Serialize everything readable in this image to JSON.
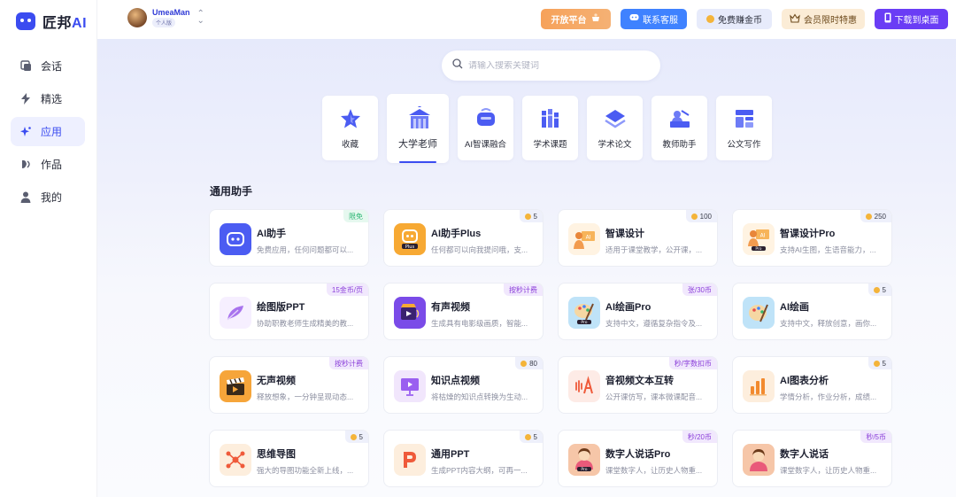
{
  "brand": {
    "name": "匠邦",
    "suffix": "AI"
  },
  "nav": [
    {
      "label": "会话",
      "icon": "chat-icon"
    },
    {
      "label": "精选",
      "icon": "lightning-icon"
    },
    {
      "label": "应用",
      "icon": "sparkle-icon",
      "active": true
    },
    {
      "label": "作品",
      "icon": "shapes-icon"
    },
    {
      "label": "我的",
      "icon": "user-icon"
    }
  ],
  "user": {
    "name": "UmeaMan",
    "badge": "个人版"
  },
  "topbar": {
    "open_platform": "开放平台",
    "service": "联系客服",
    "coins": "免费赚金币",
    "vip": "会员限时特惠",
    "download": "下载到桌面"
  },
  "search": {
    "placeholder": "请输入搜索关键词"
  },
  "categories": [
    {
      "label": "收藏",
      "icon": "star-icon"
    },
    {
      "label": "大学老师",
      "icon": "university-icon",
      "active": true
    },
    {
      "label": "AI智课融合",
      "icon": "ai-class-icon"
    },
    {
      "label": "学术课题",
      "icon": "books-icon"
    },
    {
      "label": "学术论文",
      "icon": "layers-icon"
    },
    {
      "label": "教师助手",
      "icon": "teacher-icon"
    },
    {
      "label": "公文写作",
      "icon": "document-icon"
    }
  ],
  "section_title": "通用助手",
  "cards": [
    {
      "title": "AI助手",
      "desc": "免费应用，任何问题都可以...",
      "badge": "限免",
      "badge_type": "free",
      "icon": "robot-icon",
      "color": "#4b5cf2"
    },
    {
      "title": "AI助手Plus",
      "desc": "任何都可以向我提问哦，支...",
      "badge": "5",
      "badge_type": "coin",
      "icon": "robot-plus-icon",
      "color": "#f7a933"
    },
    {
      "title": "智课设计",
      "desc": "适用于课堂教学，公开课，...",
      "badge": "100",
      "badge_type": "coin",
      "icon": "teacher-board-icon",
      "color": "#fde4c4"
    },
    {
      "title": "智课设计Pro",
      "desc": "支持AI生图，生语音能力，...",
      "badge": "250",
      "badge_type": "coin",
      "icon": "teacher-board-pro-icon",
      "color": "#fde4c4"
    },
    {
      "title": "绘图版PPT",
      "desc": "协助职教老师生成精美的教...",
      "badge": "15金币/页",
      "badge_type": "purple",
      "icon": "feather-icon",
      "color": "#f3eafd"
    },
    {
      "title": "有声视频",
      "desc": "生成具有电影级画质，智能...",
      "badge": "按秒计费",
      "badge_type": "purple",
      "icon": "video-sound-icon",
      "color": "#7a4be8"
    },
    {
      "title": "AI绘画Pro",
      "desc": "支持中文，遵循复杂指令及...",
      "badge": "张/30币",
      "badge_type": "purple",
      "icon": "palette-pro-icon",
      "color": "#a9d8f5"
    },
    {
      "title": "AI绘画",
      "desc": "支持中文，释放创意，画你...",
      "badge": "5",
      "badge_type": "coin",
      "icon": "palette-icon",
      "color": "#a9d8f5"
    },
    {
      "title": "无声视频",
      "desc": "释放想象，一分钟呈现动态...",
      "badge": "按秒计费",
      "badge_type": "purple",
      "icon": "clapper-icon",
      "color": "#f6a53a"
    },
    {
      "title": "知识点视频",
      "desc": "将枯燥的知识点转换为生动...",
      "badge": "80",
      "badge_type": "coin",
      "icon": "presentation-icon",
      "color": "#efe2fb"
    },
    {
      "title": "音视频文本互转",
      "desc": "公开课仿写，课本微课配音...",
      "badge": "秒/字数扣币",
      "badge_type": "purple",
      "icon": "audio-text-icon",
      "color": "#fde5df"
    },
    {
      "title": "AI图表分析",
      "desc": "学情分析，作业分析，成绩...",
      "badge": "5",
      "badge_type": "coin",
      "icon": "bar-chart-icon",
      "color": "#fde8d4"
    },
    {
      "title": "思维导图",
      "desc": "强大的导图功能全新上线，...",
      "badge": "5",
      "badge_type": "coin",
      "icon": "mindmap-icon",
      "color": "#fde8d4"
    },
    {
      "title": "通用PPT",
      "desc": "生成PPT内容大纲，可再一...",
      "badge": "5",
      "badge_type": "coin",
      "icon": "ppt-icon",
      "color": "#fde8d4"
    },
    {
      "title": "数字人说话Pro",
      "desc": "课堂数字人，让历史人物重...",
      "badge": "秒/20币",
      "badge_type": "purple",
      "icon": "digital-human-pro-icon",
      "color": "#f6c6a8"
    },
    {
      "title": "数字人说话",
      "desc": "课堂数字人，让历史人物重...",
      "badge": "秒/5币",
      "badge_type": "purple",
      "icon": "digital-human-icon",
      "color": "#f6c6a8"
    }
  ]
}
